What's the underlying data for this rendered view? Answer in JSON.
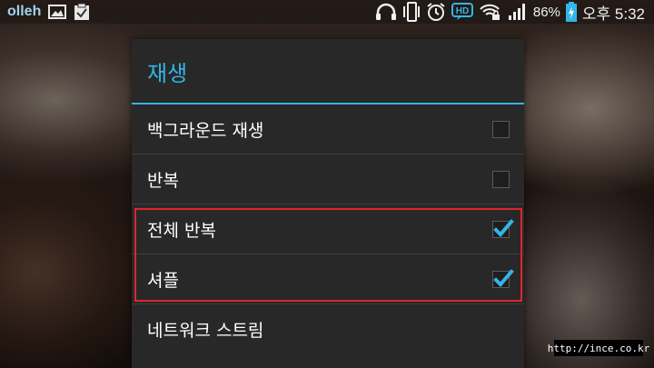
{
  "statusbar": {
    "carrier": "olleh",
    "battery_percent": "86%",
    "time": "오후 5:32",
    "hd_badge": "HD",
    "icons_left": [
      "gallery-icon",
      "clipboard-check-icon"
    ],
    "icons_right": [
      "headphones-icon",
      "vibrate-icon",
      "alarm-icon",
      "hd-icon",
      "wifi-lock-icon",
      "signal-icon",
      "battery-charging-icon"
    ]
  },
  "dialog": {
    "title": "재생",
    "accent_color": "#33b5e5",
    "options": [
      {
        "label": "백그라운드 재생",
        "checked": false
      },
      {
        "label": "반복",
        "checked": false
      },
      {
        "label": "전체 반복",
        "checked": true
      },
      {
        "label": "셔플",
        "checked": true
      },
      {
        "label": "네트워크 스트림",
        "checked": null
      }
    ]
  },
  "highlight_color": "#e0242b",
  "watermark": "http://ince.co.kr"
}
